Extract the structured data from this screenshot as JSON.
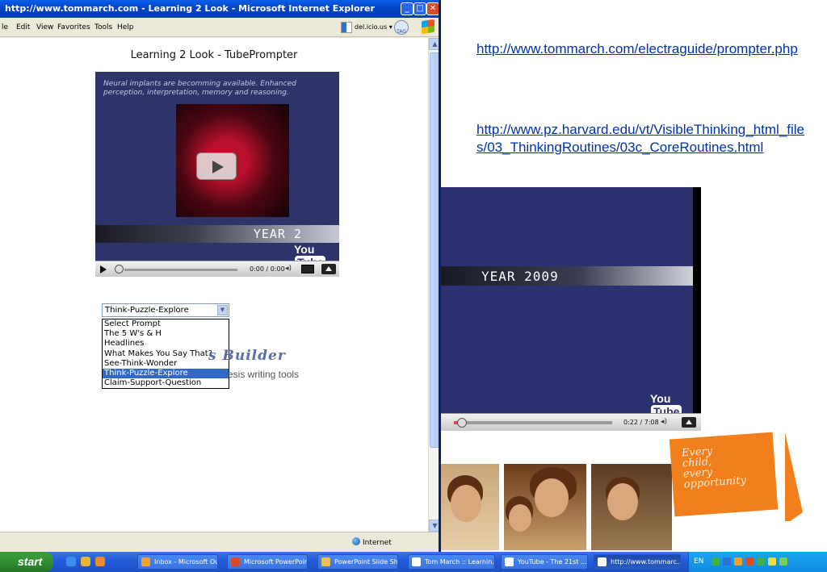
{
  "window": {
    "title": "http://www.tommarch.com - Learning 2 Look - Microsoft Internet Explorer",
    "menu": [
      "le",
      "Edit",
      "View",
      "Favorites",
      "Tools",
      "Help"
    ],
    "delicious_label": "del.icio.us",
    "tag_label": "TAG",
    "status_zone": "Internet"
  },
  "page": {
    "heading": "Learning 2 Look - TubePrompter",
    "video": {
      "overlay_text": "Neural implants are becomming available. Enhanced perception, interpretation, memory and reasoning.",
      "year_label": "YEAR 2",
      "time": "0:00 / 0:00",
      "logo_you": "You",
      "logo_tube": "Tube"
    },
    "prompt_select": {
      "selected": "Think-Puzzle-Explore",
      "options": [
        "Select Prompt",
        "The 5 W's & H",
        "Headlines",
        "What Makes You Say That?",
        "See-Think-Wonder",
        "Think-Puzzle-Explore",
        "Claim-Support-Question"
      ]
    },
    "builder_logo": "s Builder",
    "builder_sub": "esis writing tools"
  },
  "right": {
    "link1": "http://www.tommarch.com/electraguide/prompter.php",
    "link2": "http://www.pz.harvard.edu/vt/VisibleThinking_html_files/03_ThinkingRoutines/03c_CoreRoutines.html",
    "video": {
      "year_label": "YEAR 2009",
      "time": "0:22 / 7:08",
      "logo_you": "You",
      "logo_tube": "Tube",
      "progress": 0.05
    },
    "badge_lines": [
      "Every",
      "child,",
      "every",
      "opportunity"
    ]
  },
  "taskbar": {
    "start_label": "start",
    "tasks": [
      "Inbox - Microsoft Ou...",
      "Microsoft PowerPoint...",
      "PowerPoint Slide Sho...",
      "Tom March :: Learnin...",
      "YouTube - The 21st ...",
      "http://www.tommarc..."
    ],
    "tray_lang": "EN"
  },
  "colors": {
    "title_blue": "#0a5ee6",
    "link_blue": "#0033aa",
    "video_navy": "#2e3369",
    "selection_blue": "#316ac5",
    "promo_orange": "#f07f1c",
    "start_green": "#2f8a2f"
  }
}
